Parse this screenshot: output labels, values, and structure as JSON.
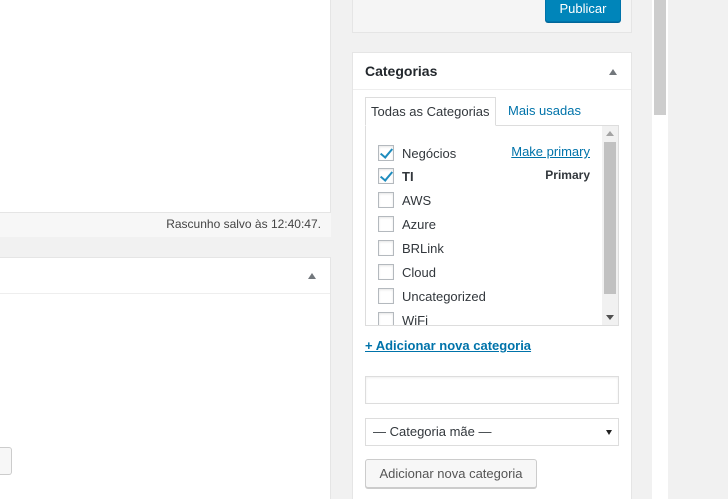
{
  "left": {
    "status_text": "Rascunho salvo às 12:40:47."
  },
  "publish": {
    "button_label": "Publicar"
  },
  "categories_box": {
    "title": "Categorias",
    "tabs": [
      {
        "label": "Todas as Categorias",
        "active": true
      },
      {
        "label": "Mais usadas",
        "active": false
      }
    ],
    "items": [
      {
        "label": "Negócios",
        "checked": true,
        "action": "Make primary"
      },
      {
        "label": "TI",
        "checked": true,
        "badge": "Primary"
      },
      {
        "label": "AWS",
        "checked": false
      },
      {
        "label": "Azure",
        "checked": false
      },
      {
        "label": "BRLink",
        "checked": false
      },
      {
        "label": "Cloud",
        "checked": false
      },
      {
        "label": "Uncategorized",
        "checked": false
      },
      {
        "label": "WiFi",
        "checked": false
      }
    ],
    "add_new_link": "+ Adicionar nova categoria",
    "new_category_value": "",
    "parent_select_value": "— Categoria mãe —",
    "add_button_label": "Adicionar nova categoria"
  },
  "colors": {
    "accent": "#0073aa",
    "primary_button": "#0085ba"
  }
}
